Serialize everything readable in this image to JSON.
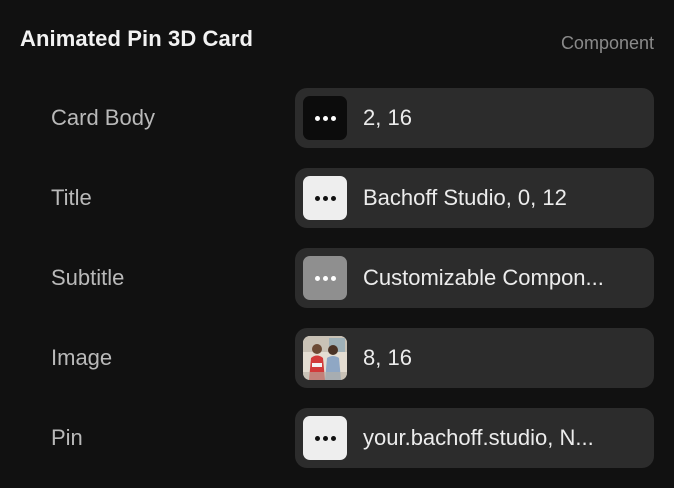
{
  "header": {
    "title": "Animated Pin 3D Card",
    "kind": "Component"
  },
  "rows": [
    {
      "label": "Card Body",
      "value": "2, 16",
      "icon": "more-dots-icon",
      "swatch": "#0c0c0c"
    },
    {
      "label": "Title",
      "value": "Bachoff Studio, 0, 12",
      "icon": "more-dots-icon",
      "swatch": "#eeeeee"
    },
    {
      "label": "Subtitle",
      "value": "Customizable Compon...",
      "icon": "more-dots-icon",
      "swatch": "#8f8f8f"
    },
    {
      "label": "Image",
      "value": "8, 16",
      "icon": "image-thumbnail",
      "swatch": "#d9d2c8"
    },
    {
      "label": "Pin",
      "value": "your.bachoff.studio, N...",
      "icon": "more-dots-icon",
      "swatch": "#eeeeee"
    }
  ],
  "colors": {
    "background": "#111111",
    "field": "#2c2c2c",
    "label": "#b9b9b9",
    "value": "#ececec",
    "muted": "#8a8a8a"
  }
}
